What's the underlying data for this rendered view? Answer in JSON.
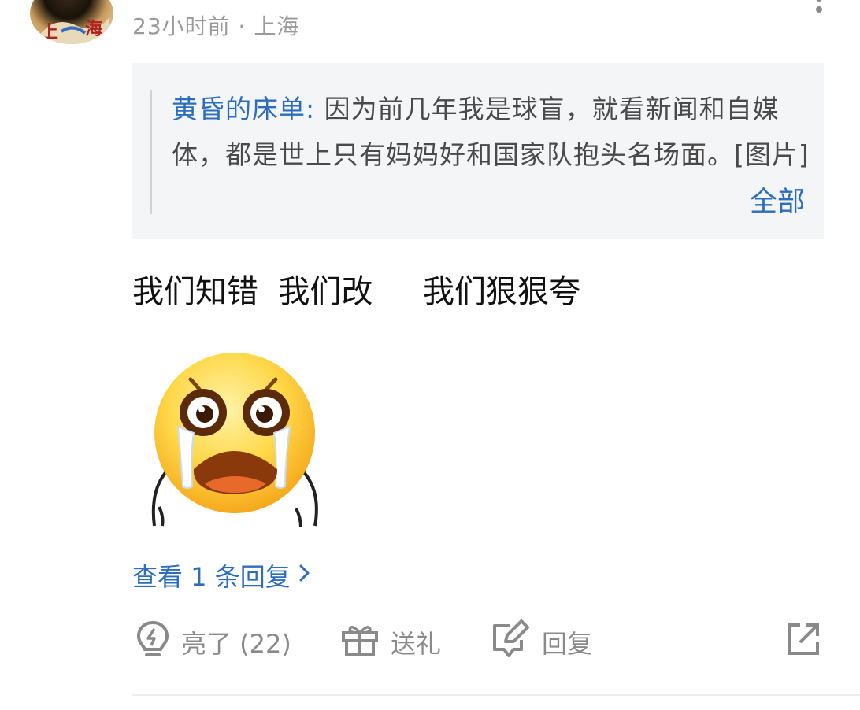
{
  "post": {
    "meta": "23小时前 · 上海",
    "quote": {
      "author": "黄昏的床单:",
      "text": " 因为前几年我是球盲，就看新闻和自媒体，都是世上只有妈妈好和国家队抱头名场面。[图片]",
      "more_label": "全部"
    },
    "comment_text": "我们知错  我们改     我们狠狠夸",
    "emoji_icon": "crying-face-sticker",
    "view_replies_label": "查看 1 条回复",
    "actions": {
      "like_label": "亮了 (22)",
      "gift_label": "送礼",
      "reply_label": "回复"
    }
  },
  "colors": {
    "link": "#2c6dbf",
    "muted": "#9a9a9a",
    "quote_bg": "#f4f5f7"
  }
}
